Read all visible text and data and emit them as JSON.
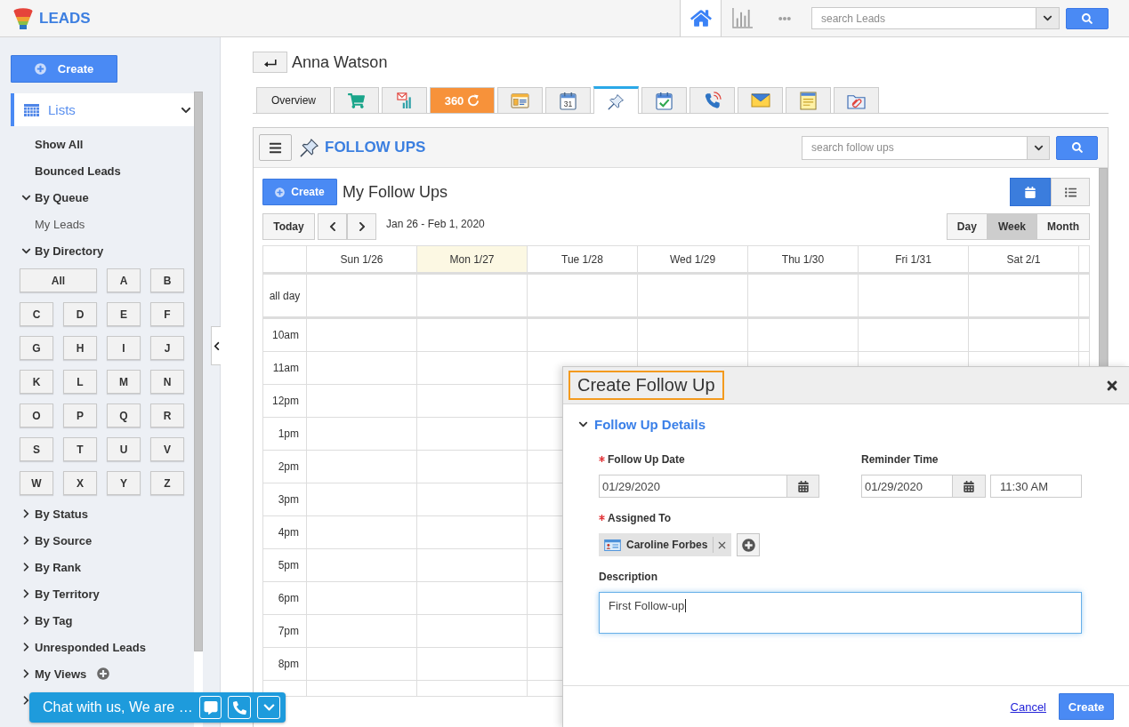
{
  "header": {
    "app_name": "LEADS",
    "nav": [
      {
        "kind": "home",
        "selected": true
      },
      {
        "kind": "reports",
        "selected": false
      },
      {
        "kind": "more",
        "selected": false
      }
    ],
    "search": {
      "placeholder": "search Leads"
    }
  },
  "sidebar": {
    "create_button": "Create",
    "lists": {
      "label": "Lists",
      "selected": true,
      "expanded": true
    },
    "items": [
      {
        "kind": "link",
        "label": "Show All"
      },
      {
        "kind": "link",
        "label": "Bounced Leads"
      },
      {
        "kind": "group",
        "label": "By Queue",
        "expanded": true,
        "children": [
          {
            "label": "My Leads"
          }
        ]
      },
      {
        "kind": "group",
        "label": "By Directory",
        "expanded": true,
        "letters": [
          "All",
          "A",
          "B",
          "C",
          "D",
          "E",
          "F",
          "G",
          "H",
          "I",
          "J",
          "K",
          "L",
          "M",
          "N",
          "O",
          "P",
          "Q",
          "R",
          "S",
          "T",
          "U",
          "V",
          "W",
          "X",
          "Y",
          "Z"
        ]
      },
      {
        "kind": "group",
        "label": "By Status",
        "expanded": false
      },
      {
        "kind": "group",
        "label": "By Source",
        "expanded": false
      },
      {
        "kind": "group",
        "label": "By Rank",
        "expanded": false
      },
      {
        "kind": "group",
        "label": "By Territory",
        "expanded": false
      },
      {
        "kind": "group",
        "label": "By Tag",
        "expanded": false
      },
      {
        "kind": "group",
        "label": "Unresponded Leads",
        "expanded": false
      },
      {
        "kind": "group",
        "label": "My Views",
        "expanded": false,
        "can_add": true
      },
      {
        "kind": "group",
        "expanded": false
      }
    ]
  },
  "record": {
    "name": "Anna Watson",
    "tabs": [
      {
        "kind": "text",
        "label": "Overview",
        "selected": false
      },
      {
        "kind": "cart",
        "selected": false
      },
      {
        "kind": "campaign",
        "selected": false
      },
      {
        "kind": "brand",
        "label": "360",
        "selected": false
      },
      {
        "kind": "form",
        "selected": false
      },
      {
        "kind": "calendar",
        "label": "31",
        "selected": false
      },
      {
        "kind": "pin",
        "selected": true
      },
      {
        "kind": "task",
        "selected": false
      },
      {
        "kind": "phone",
        "selected": false
      },
      {
        "kind": "mail",
        "selected": false
      },
      {
        "kind": "note",
        "selected": false
      },
      {
        "kind": "attachment",
        "selected": false
      }
    ]
  },
  "follow_ups": {
    "title": "FOLLOW UPS",
    "search": {
      "placeholder": "search follow ups"
    },
    "create_button": "Create",
    "heading": "My Follow Ups",
    "views": [
      {
        "kind": "calendar",
        "selected": true
      },
      {
        "kind": "list",
        "selected": false
      }
    ],
    "today_button": "Today",
    "date_range": "Jan 26 - Feb 1, 2020",
    "periods": [
      {
        "label": "Day",
        "selected": false
      },
      {
        "label": "Week",
        "selected": true
      },
      {
        "label": "Month",
        "selected": false
      }
    ],
    "calendar": {
      "days": [
        {
          "label": "Sun 1/26",
          "today": false
        },
        {
          "label": "Mon 1/27",
          "today": true
        },
        {
          "label": "Tue 1/28",
          "today": false
        },
        {
          "label": "Wed 1/29",
          "today": false
        },
        {
          "label": "Thu 1/30",
          "today": false
        },
        {
          "label": "Fri 1/31",
          "today": false
        },
        {
          "label": "Sat 2/1",
          "today": false
        }
      ],
      "all_day_label": "all day",
      "hours": [
        "10am",
        "11am",
        "12pm",
        "1pm",
        "2pm",
        "3pm",
        "4pm",
        "5pm",
        "6pm",
        "7pm",
        "8pm"
      ]
    }
  },
  "create_dialog": {
    "title": "Create Follow Up",
    "section": {
      "title": "Follow Up Details",
      "expanded": true
    },
    "fields": [
      {
        "kind": "date",
        "label": "Follow Up Date",
        "required": true,
        "value": "01/29/2020"
      },
      {
        "kind": "datetime",
        "label": "Reminder Time",
        "required": false,
        "date": "01/29/2020",
        "time": "11:30 AM"
      },
      {
        "kind": "assignees",
        "label": "Assigned To",
        "required": true,
        "people": [
          {
            "name": "Caroline Forbes"
          }
        ]
      },
      {
        "kind": "textarea",
        "label": "Description",
        "required": false,
        "value": "First Follow-up",
        "focused": true
      }
    ],
    "cancel_link": "Cancel",
    "submit_button": "Create"
  },
  "chat_widget": {
    "text": "Chat with us, We are …"
  }
}
